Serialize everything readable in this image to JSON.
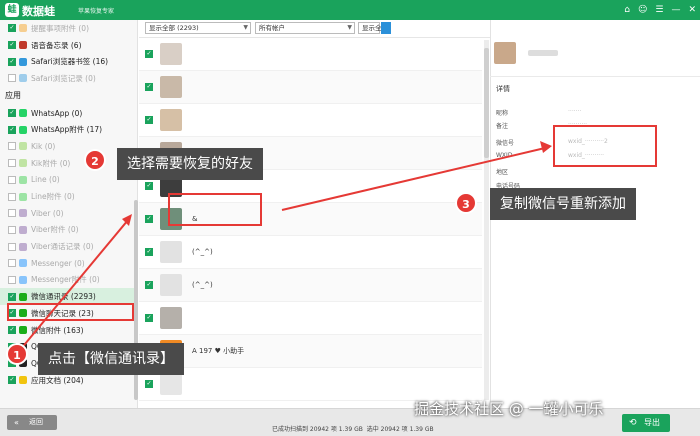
{
  "titlebar": {
    "logo_glyph": "蛙",
    "app_name": "数据蛙",
    "subtitle": "苹果恢复专家",
    "buttons": [
      "⌂",
      "☺",
      "☰",
      "—",
      "✕"
    ]
  },
  "sidebar": {
    "items": [
      {
        "label": "提醒事项附件 (0)",
        "checked": true,
        "dim": true,
        "icon": "reminder-icon",
        "color": "#f39c12"
      },
      {
        "label": "语音备忘录 (6)",
        "checked": true,
        "dim": false,
        "icon": "voice-memo-icon",
        "color": "#c0392b"
      },
      {
        "label": "Safari浏览器书签 (16)",
        "checked": true,
        "dim": false,
        "icon": "safari-icon",
        "color": "#3498db"
      },
      {
        "label": "Safari浏览记录 (0)",
        "checked": false,
        "dim": true,
        "icon": "safari-icon",
        "color": "#3498db"
      }
    ],
    "group_label": "应用",
    "app_items": [
      {
        "label": "WhatsApp (0)",
        "checked": true,
        "dim": false,
        "icon": "whatsapp-icon",
        "color": "#25d366"
      },
      {
        "label": "WhatsApp附件 (17)",
        "checked": true,
        "dim": false,
        "icon": "whatsapp-icon",
        "color": "#25d366"
      },
      {
        "label": "Kik (0)",
        "checked": false,
        "dim": true,
        "icon": "kik-icon",
        "color": "#7ccd3c"
      },
      {
        "label": "Kik附件 (0)",
        "checked": false,
        "dim": true,
        "icon": "kik-icon",
        "color": "#7ccd3c"
      },
      {
        "label": "Line (0)",
        "checked": false,
        "dim": true,
        "icon": "line-icon",
        "color": "#2ecc40"
      },
      {
        "label": "Line附件 (0)",
        "checked": false,
        "dim": true,
        "icon": "line-icon",
        "color": "#2ecc40"
      },
      {
        "label": "Viber (0)",
        "checked": false,
        "dim": true,
        "icon": "viber-icon",
        "color": "#7b519d"
      },
      {
        "label": "Viber附件 (0)",
        "checked": false,
        "dim": true,
        "icon": "viber-icon",
        "color": "#7b519d"
      },
      {
        "label": "Viber通话记录 (0)",
        "checked": false,
        "dim": true,
        "icon": "viber-icon",
        "color": "#7b519d"
      },
      {
        "label": "Messenger (0)",
        "checked": false,
        "dim": true,
        "icon": "messenger-icon",
        "color": "#0084ff"
      },
      {
        "label": "Messenger附件 (0)",
        "checked": false,
        "dim": true,
        "icon": "messenger-icon",
        "color": "#0084ff"
      },
      {
        "label": "微信通讯录 (2293)",
        "checked": true,
        "dim": false,
        "selected": true,
        "icon": "wechat-icon",
        "color": "#1aad19"
      },
      {
        "label": "微信聊天记录 (23)",
        "checked": true,
        "dim": false,
        "icon": "wechat-icon",
        "color": "#1aad19"
      },
      {
        "label": "微信附件 (163)",
        "checked": true,
        "dim": false,
        "icon": "wechat-icon",
        "color": "#1aad19"
      },
      {
        "label": "QQ (0)",
        "checked": true,
        "dim": false,
        "icon": "qq-icon",
        "color": "#222222"
      },
      {
        "label": "QQ附件 (5101)",
        "checked": true,
        "dim": false,
        "icon": "qq-icon",
        "color": "#222222"
      },
      {
        "label": "应用文档 (204)",
        "checked": true,
        "dim": false,
        "icon": "app-docs-icon",
        "color": "#f1c40f"
      }
    ]
  },
  "filters": {
    "display": "显示全部 (2293)",
    "account": "所有帐户",
    "show_all": "显示全部"
  },
  "contacts": [
    {
      "name": "",
      "checked": true,
      "color": "#d9cfc6"
    },
    {
      "name": "",
      "checked": true,
      "color": "#c9b9a8"
    },
    {
      "name": "",
      "checked": true,
      "color": "#d6c0a6"
    },
    {
      "name": "",
      "checked": true,
      "color": "#b8a89a"
    },
    {
      "name": "",
      "checked": true,
      "color": "#3d3d3d"
    },
    {
      "name": "&",
      "checked": true,
      "color": "#6f8f7a"
    },
    {
      "name": "(^_^)",
      "checked": true,
      "color": "#e2e2e2"
    },
    {
      "name": "(^_^)",
      "checked": true,
      "color": "#e2e2e2"
    },
    {
      "name": "",
      "checked": true,
      "color": "#b5b0aa"
    },
    {
      "name": "A 197 ♥ 小助手",
      "checked": true,
      "color": "#f08a24"
    },
    {
      "name": "",
      "checked": true,
      "color": "#e6e6e6"
    }
  ],
  "detail": {
    "section_title": "详情",
    "fields": [
      {
        "label": "昵称",
        "value": "·······"
      },
      {
        "label": "备注",
        "value": "··········"
      },
      {
        "label": "微信号",
        "value": "wxid_··········2"
      },
      {
        "label": "WXID",
        "value": "wxid_··········"
      },
      {
        "label": "地区",
        "value": ""
      },
      {
        "label": "电话号码",
        "value": ""
      }
    ]
  },
  "callouts": {
    "step1_number": "1",
    "step1_text": "点击【微信通讯录】",
    "step2_number": "2",
    "step2_text": "选择需要恢复的好友",
    "step3_number": "3",
    "step3_text": "复制微信号重新添加",
    "annotation_color": "#e53935"
  },
  "bottombar": {
    "back_label": "返回",
    "back_glyph": "«",
    "status_scanned": "已成功扫描到 20942 项 1.39 GB",
    "status_selected": "选中 20942 项 1.39 GB",
    "export_label": "导出",
    "export_glyph": "⟲"
  },
  "watermark": "掘金技术社区 @ 一罐小可乐",
  "accent_color": "#1aa35c"
}
